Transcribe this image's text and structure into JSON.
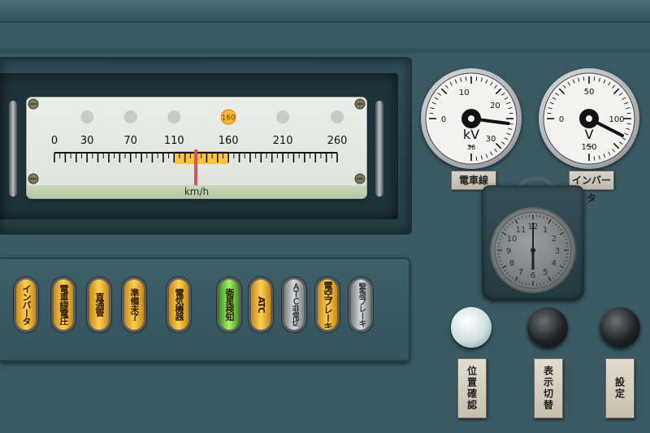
{
  "speedometer": {
    "unit": "km/h",
    "scale_labels": [
      "0",
      "30",
      "70",
      "110",
      "160",
      "210",
      "260"
    ],
    "atc_limit_badge": "160",
    "current_speed_kmh": 130,
    "band_color": "#ffc43a"
  },
  "gauges": {
    "line_voltage": {
      "label": "電車線",
      "unit": "kV",
      "unit_symbol": "~",
      "scale_labels": [
        "0",
        "10",
        "20",
        "30",
        "36"
      ],
      "value": 25
    },
    "inverter": {
      "label": "インバータ",
      "unit": "V",
      "unit_symbol": "~",
      "scale_labels": [
        "0",
        "50",
        "100",
        "150"
      ],
      "value": 115
    }
  },
  "lamps": [
    {
      "label": "インバータ",
      "color": "amber"
    },
    {
      "label": "電車線電圧",
      "color": "amber"
    },
    {
      "label": "直通管",
      "color": "amber"
    },
    {
      "label": "準備未了",
      "color": "amber"
    },
    {
      "label": "電気機器",
      "color": "amber"
    },
    {
      "label": "衛星検知",
      "color": "green"
    },
    {
      "label": "ATC",
      "color": "amber"
    },
    {
      "label": "ＡＴＣ非常切",
      "color": "gray"
    },
    {
      "label": "電空ブレーキ",
      "color": "amber"
    },
    {
      "label": "緊急ブレーキ",
      "color": "gray"
    }
  ],
  "buttons": [
    {
      "label": "位置確認",
      "color": "white"
    },
    {
      "label": "表示切替",
      "color": "black"
    },
    {
      "label": "設定",
      "color": "black"
    }
  ]
}
